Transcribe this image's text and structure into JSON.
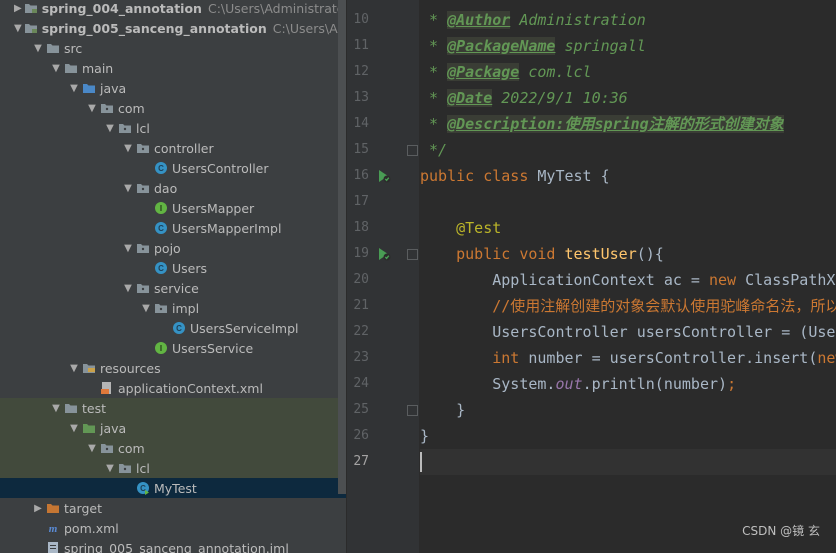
{
  "project_tree": {
    "rows": [
      {
        "label": "spring_004_annotation",
        "path": "C:\\Users\\Administrator\\Ide",
        "bold": true,
        "arrow": "▶",
        "icon": "module-icon"
      },
      {
        "label": "spring_005_sanceng_annotation",
        "path": "C:\\Users\\Adminis",
        "bold": true,
        "arrow": "▼",
        "icon": "module-icon"
      },
      {
        "label": "src",
        "arrow": "▼",
        "icon": "folder-icon"
      },
      {
        "label": "main",
        "arrow": "▼",
        "icon": "folder-icon"
      },
      {
        "label": "java",
        "arrow": "▼",
        "icon": "source-folder-icon"
      },
      {
        "label": "com",
        "arrow": "▼",
        "icon": "package-icon"
      },
      {
        "label": "lcl",
        "arrow": "▼",
        "icon": "package-icon"
      },
      {
        "label": "controller",
        "arrow": "▼",
        "icon": "package-icon"
      },
      {
        "label": "UsersController",
        "arrow": "",
        "icon": "class-icon"
      },
      {
        "label": "dao",
        "arrow": "▼",
        "icon": "package-icon"
      },
      {
        "label": "UsersMapper",
        "arrow": "",
        "icon": "interface-icon"
      },
      {
        "label": "UsersMapperImpl",
        "arrow": "",
        "icon": "class-icon"
      },
      {
        "label": "pojo",
        "arrow": "▼",
        "icon": "package-icon"
      },
      {
        "label": "Users",
        "arrow": "",
        "icon": "class-icon"
      },
      {
        "label": "service",
        "arrow": "▼",
        "icon": "package-icon"
      },
      {
        "label": "impl",
        "arrow": "▼",
        "icon": "package-icon"
      },
      {
        "label": "UsersServiceImpl",
        "arrow": "",
        "icon": "class-icon"
      },
      {
        "label": "UsersService",
        "arrow": "",
        "icon": "interface-icon"
      },
      {
        "label": "resources",
        "arrow": "▼",
        "icon": "resources-folder-icon"
      },
      {
        "label": "applicationContext.xml",
        "arrow": "",
        "icon": "xml-file-icon"
      },
      {
        "label": "test",
        "arrow": "▼",
        "icon": "folder-icon"
      },
      {
        "label": "java",
        "arrow": "▼",
        "icon": "test-source-folder-icon"
      },
      {
        "label": "com",
        "arrow": "▼",
        "icon": "package-icon"
      },
      {
        "label": "lcl",
        "arrow": "▼",
        "icon": "package-icon"
      },
      {
        "label": "MyTest",
        "arrow": "",
        "icon": "test-class-icon"
      },
      {
        "label": "target",
        "arrow": "▶",
        "icon": "excluded-folder-icon"
      },
      {
        "label": "pom.xml",
        "arrow": "",
        "icon": "maven-icon"
      },
      {
        "label": "spring_005_sanceng_annotation.iml",
        "arrow": "",
        "icon": "iml-file-icon"
      }
    ]
  },
  "editor": {
    "line_numbers": [
      "10",
      "11",
      "12",
      "13",
      "14",
      "15",
      "16",
      "17",
      "18",
      "19",
      "20",
      "21",
      "22",
      "23",
      "24",
      "25",
      "26",
      "27"
    ],
    "current_line": "27",
    "lines": [
      {
        "n": "10",
        "parts": [
          {
            "t": " * ",
            "c": "doc"
          },
          {
            "t": "@Author",
            "c": "tag"
          },
          {
            "t": " Administration",
            "c": "tagval"
          }
        ]
      },
      {
        "n": "11",
        "parts": [
          {
            "t": " * ",
            "c": "doc"
          },
          {
            "t": "@PackageName",
            "c": "tag"
          },
          {
            "t": " springall",
            "c": "tagval"
          }
        ]
      },
      {
        "n": "12",
        "parts": [
          {
            "t": " * ",
            "c": "doc"
          },
          {
            "t": "@Package",
            "c": "tag"
          },
          {
            "t": " com.lcl",
            "c": "tagval"
          }
        ]
      },
      {
        "n": "13",
        "parts": [
          {
            "t": " * ",
            "c": "doc"
          },
          {
            "t": "@Date",
            "c": "tag"
          },
          {
            "t": " 2022/9/1 10:36",
            "c": "tagval"
          }
        ]
      },
      {
        "n": "14",
        "parts": [
          {
            "t": " * ",
            "c": "doc"
          },
          {
            "t": "@Description:使用spring注解的形式创建对象",
            "c": "tag"
          }
        ]
      },
      {
        "n": "15",
        "parts": [
          {
            "t": " */",
            "c": "doc"
          }
        ]
      },
      {
        "n": "16",
        "parts": [
          {
            "t": "public class ",
            "c": "kw"
          },
          {
            "t": "MyTest {",
            "c": "plain"
          }
        ]
      },
      {
        "n": "17",
        "parts": []
      },
      {
        "n": "18",
        "parts": [
          {
            "t": "    ",
            "c": "plain"
          },
          {
            "t": "@Test",
            "c": "ann"
          }
        ]
      },
      {
        "n": "19",
        "parts": [
          {
            "t": "    ",
            "c": "plain"
          },
          {
            "t": "public void ",
            "c": "kw"
          },
          {
            "t": "testUser",
            "c": "fn"
          },
          {
            "t": "(){",
            "c": "plain"
          }
        ]
      },
      {
        "n": "20",
        "parts": [
          {
            "t": "        ApplicationContext ac = ",
            "c": "plain"
          },
          {
            "t": "new ",
            "c": "kw"
          },
          {
            "t": "ClassPathXmlApplicationContext(",
            "c": "plain"
          }
        ]
      },
      {
        "n": "21",
        "parts": [
          {
            "t": "        ",
            "c": "plain"
          },
          {
            "t": "//使用注解创建的对象会默认使用驼峰命名法，所以",
            "c": "cmtcn"
          }
        ]
      },
      {
        "n": "22",
        "parts": [
          {
            "t": "        UsersController usersController = (UsersController)",
            "c": "plain"
          }
        ]
      },
      {
        "n": "23",
        "parts": [
          {
            "t": "        ",
            "c": "plain"
          },
          {
            "t": "int ",
            "c": "kw"
          },
          {
            "t": "number = usersController.insert(",
            "c": "plain"
          },
          {
            "t": "new",
            "c": "kw"
          }
        ]
      },
      {
        "n": "24",
        "parts": [
          {
            "t": "        System.",
            "c": "plain"
          },
          {
            "t": "out",
            "c": "static"
          },
          {
            "t": ".println(number)",
            "c": "plain"
          },
          {
            "t": ";",
            "c": "kw"
          }
        ]
      },
      {
        "n": "25",
        "parts": [
          {
            "t": "    }",
            "c": "plain"
          }
        ]
      },
      {
        "n": "26",
        "parts": [
          {
            "t": "}",
            "c": "plain"
          }
        ]
      },
      {
        "n": "27",
        "parts": []
      }
    ]
  },
  "watermark": "CSDN @镜 玄",
  "colors": {
    "panel_bg": "#3c3f41",
    "editor_bg": "#2b2b2b",
    "selection": "#0d293e",
    "keyword": "#cc7832",
    "javadoc": "#629755",
    "annotation": "#bbb529",
    "method": "#ffc66d"
  }
}
